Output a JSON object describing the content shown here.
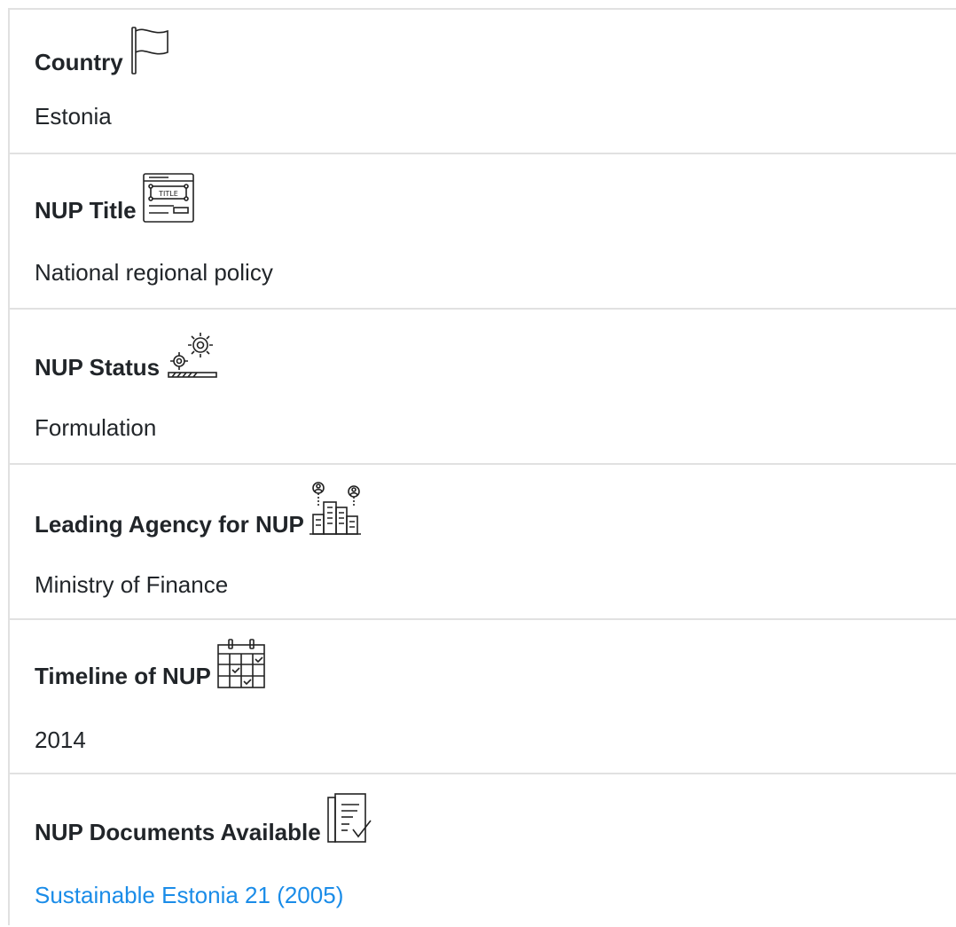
{
  "fields": [
    {
      "label": "Country",
      "value": "Estonia",
      "icon": "flag-icon"
    },
    {
      "label": "NUP Title",
      "value": "National regional policy",
      "icon": "title-window-icon"
    },
    {
      "label": "NUP Status",
      "value": "Formulation",
      "icon": "gears-progress-icon"
    },
    {
      "label": "Leading Agency for NUP",
      "value": "Ministry of Finance",
      "icon": "city-buildings-people-icon"
    },
    {
      "label": "Timeline of NUP",
      "value": "2014",
      "icon": "calendar-check-icon"
    },
    {
      "label": "NUP Documents Available",
      "value": "Sustainable Estonia 21 (2005)",
      "icon": "document-check-icon"
    }
  ],
  "colors": {
    "text": "#212529",
    "link": "#1a8ce8",
    "border": "#e1e1e1"
  }
}
